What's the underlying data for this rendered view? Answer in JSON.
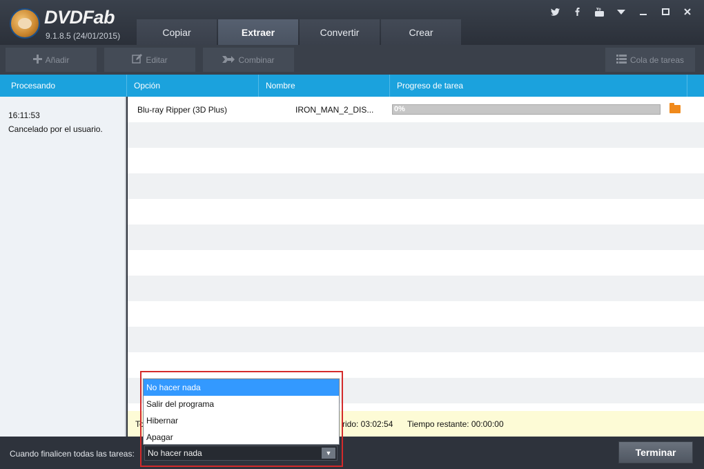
{
  "app": {
    "brand": "DVDFab",
    "version": "9.1.8.5 (24/01/2015)"
  },
  "tabs": [
    "Copiar",
    "Extraer",
    "Convertir",
    "Crear"
  ],
  "active_tab": "Extraer",
  "window_controls": [
    "twitter-icon",
    "facebook-icon",
    "youtube-icon",
    "menu-arrow-icon",
    "minimize-icon",
    "maximize-icon",
    "close-icon"
  ],
  "toolbar": {
    "add": "Añadir",
    "edit": "Editar",
    "combine": "Combinar",
    "queue": "Cola de tareas"
  },
  "columns": {
    "processing": "Procesando",
    "option": "Opción",
    "name": "Nombre",
    "progress": "Progreso de tarea"
  },
  "left_panel": {
    "time": "16:11:53",
    "message": "Cancelado por el usuario."
  },
  "task": {
    "option": "Blu-ray Ripper (3D Plus)",
    "name": "IRON_MAN_2_DIS...",
    "progress_label": "0%",
    "progress_value": 0
  },
  "status": {
    "prefix": "To",
    "elapsed": "rido: 03:02:54",
    "remaining": "Tiempo restante: 00:00:00"
  },
  "footer": {
    "label": "Cuando finalicen todas las tareas:",
    "selected": "No hacer nada",
    "finish_button": "Terminar"
  },
  "dropdown_options": [
    "No hacer nada",
    "Salir del programa",
    "Hibernar",
    "Apagar"
  ],
  "colors": {
    "accent_blue": "#1ba2dd",
    "highlight_red": "#d42a2a",
    "selection_blue": "#3399ff",
    "folder_orange": "#f08a1c"
  }
}
